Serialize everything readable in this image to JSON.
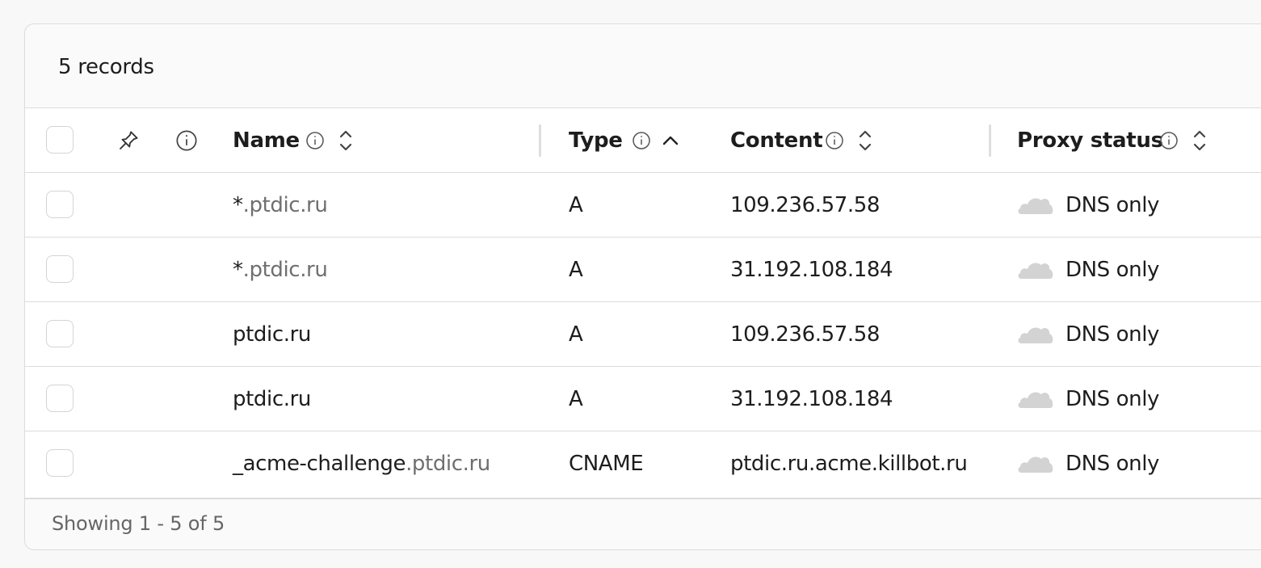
{
  "summary": {
    "record_count_label": "5 records"
  },
  "columns": {
    "name": "Name",
    "type": "Type",
    "content": "Content",
    "proxy_status": "Proxy status"
  },
  "rows": [
    {
      "name_prefix": "*",
      "name_domain": ".ptdic.ru",
      "type": "A",
      "content": "109.236.57.58",
      "proxy": "DNS only"
    },
    {
      "name_prefix": "*",
      "name_domain": ".ptdic.ru",
      "type": "A",
      "content": "31.192.108.184",
      "proxy": "DNS only"
    },
    {
      "name_prefix": "ptdic.ru",
      "name_domain": "",
      "type": "A",
      "content": "109.236.57.58",
      "proxy": "DNS only"
    },
    {
      "name_prefix": "ptdic.ru",
      "name_domain": "",
      "type": "A",
      "content": "31.192.108.184",
      "proxy": "DNS only"
    },
    {
      "name_prefix": "_acme-challenge",
      "name_domain": ".ptdic.ru",
      "type": "CNAME",
      "content": "ptdic.ru.acme.killbot.ru",
      "proxy": "DNS only"
    }
  ],
  "pagination": {
    "label": "Showing 1 - 5 of 5"
  },
  "colors": {
    "cloud_dns_only": "#d3d3d3",
    "muted_text": "#6f6f6f",
    "border": "#dcdcdc"
  },
  "icons": {
    "pin": "pin-icon",
    "info": "info-icon",
    "sort": "sort-icon",
    "sort_ascending": "sort-ascending-icon",
    "cloud": "cloud-icon"
  }
}
